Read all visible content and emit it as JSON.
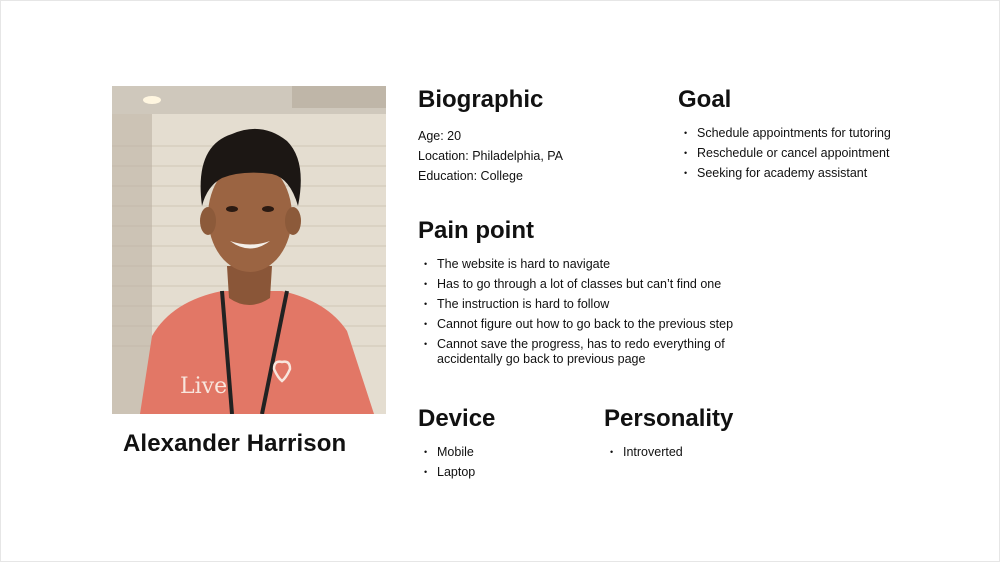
{
  "persona": {
    "name": "Alexander Harrison",
    "photo_caption": "Live"
  },
  "biographic": {
    "heading": "Biographic",
    "items": [
      "Age: 20",
      "Location: Philadelphia, PA",
      "Education: College"
    ]
  },
  "goal": {
    "heading": "Goal",
    "items": [
      "Schedule appointments for tutoring",
      "Reschedule or cancel appointment",
      "Seeking for academy assistant"
    ]
  },
  "pain_point": {
    "heading": "Pain point",
    "items": [
      "The website is hard to navigate",
      "Has to go through a lot of classes but can’t find one",
      "The instruction is hard to follow",
      "Cannot figure out how to go back to the previous step",
      "Cannot save the progress, has to redo everything of accidentally go back to previous page"
    ]
  },
  "device": {
    "heading": "Device",
    "items": [
      "Mobile",
      "Laptop"
    ]
  },
  "personality": {
    "heading": "Personality",
    "items": [
      "Introverted"
    ]
  },
  "bullet_glyph": "•"
}
